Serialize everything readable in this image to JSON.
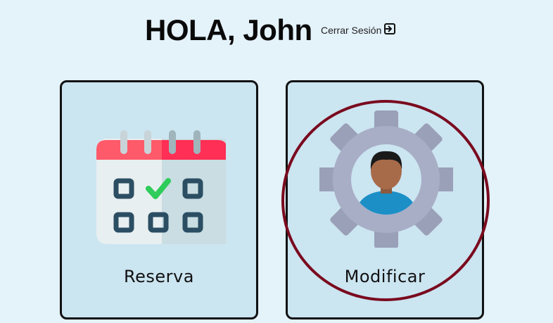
{
  "header": {
    "greeting": "HOLA, John",
    "logout_label": "Cerrar Sesión",
    "logout_icon": "logout-arrow-icon"
  },
  "cards": [
    {
      "label": "Reserva",
      "icon": "calendar-check-icon"
    },
    {
      "label": "Modificar",
      "icon": "gear-user-icon"
    }
  ],
  "colors": {
    "background": "#e4f2fa",
    "card_background": "#cbe5f1",
    "highlight_ring": "#7a0a1e",
    "calendar_header": "#ff5a6a",
    "calendar_check": "#2ecc5a",
    "gear": "#a8aec6",
    "avatar_shirt": "#1c8fc6"
  }
}
